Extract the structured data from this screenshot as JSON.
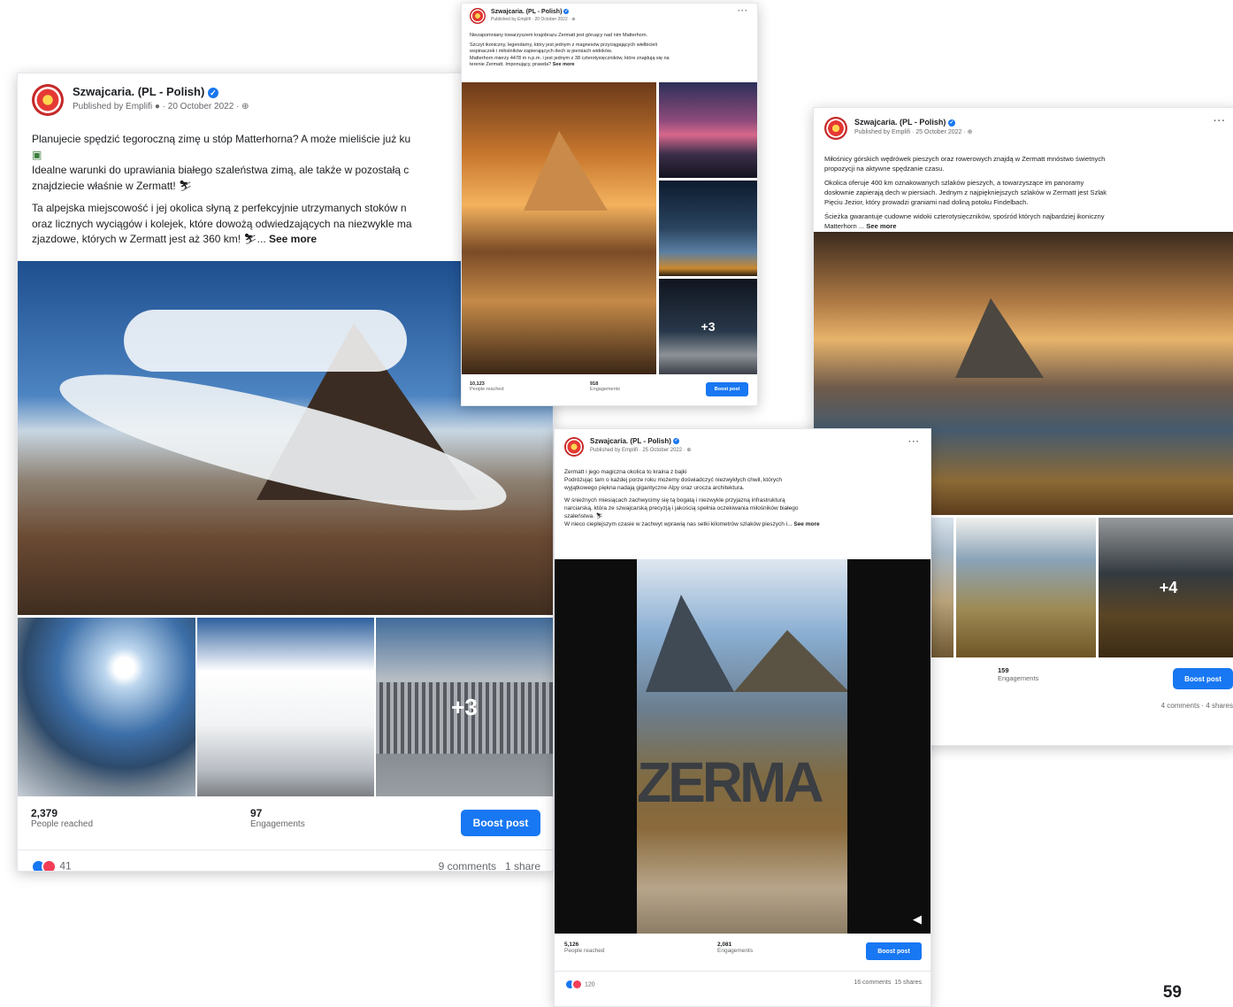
{
  "page_number": "59",
  "posts": [
    {
      "page_name": "Szwajcaria. (PL - Polish)",
      "published_by": "Published by Emplifi",
      "date": "20 October 2022",
      "text": [
        "Planujecie spędzić tegoroczną zimę u stóp Matterhorna? A może mieliście już ku",
        "Idealne warunki do uprawiania białego szaleństwa zimą, ale także w pozostałą c",
        "znajdziecie właśnie w Zermatt! ⛷",
        "Ta alpejska miejscowość i jej okolica słyną z perfekcyjnie utrzymanych stoków n",
        "oraz licznych wyciągów i kolejek, które dowożą odwiedzających na niezwykle ma",
        "zjazdowe, których w Zermatt jest aż 360 km! ⛷... "
      ],
      "see_more": "See more",
      "more_photos": "+3",
      "reach_value": "2,379",
      "reach_label": "People reached",
      "engage_value": "97",
      "engage_label": "Engagements",
      "boost": "Boost post",
      "reactions": "41",
      "comments": "9 comments",
      "shares": "1 share"
    },
    {
      "page_name": "Szwajcaria. (PL - Polish)",
      "published_by": "Published by Emplifi",
      "date": "20 October 2022",
      "text": [
        "Niezapomniany towarzyszem krajobrazu Zermatt jest góruący nad nim Matterhorn.",
        "Szczyt ikoniczny, legendarny, który jest jednym z magnesów przyciągających wielbicieli",
        "wspinaczek i miłośników zapierających dech w piersiach widoków.",
        "Matterhorn mierzy 4478 m n.p.m. i jest jednym z 38 czterotysięczników, które znajdują się na",
        "terenie Zermatt. Imponujący, prawda? "
      ],
      "see_more": "See more",
      "more_photos": "+3",
      "reach_value": "10,123",
      "reach_label": "People reached",
      "engage_value": "918",
      "engage_label": "Engagements",
      "boost": "Boost post"
    },
    {
      "page_name": "Szwajcaria. (PL - Polish)",
      "published_by": "Published by Emplifi",
      "date": "25 October 2022",
      "text": [
        "Miłośnicy górskich wędrówek pieszych oraz rowerowych znajdą w Zermatt mnóstwo świetnych",
        "propozycji na aktywne spędzanie czasu.",
        "Okolica oferuje 400 km oznakowanych szlaków pieszych, a towarzyszące im panoramy",
        "dosłownie zapierają dech w piersiach. Jednym z najpiękniejszych szlaków w Zermatt jest Szlak",
        "Pięciu Jezior, który prowadzi graniami nad doliną potoku Findelbach.",
        "Ścieżka gwarantuje cudowne widoki czterotysięczników, spośród których najbardziej ikoniczny",
        "Matterhorn ... "
      ],
      "see_more": "See more",
      "more_photos": "+4",
      "engage_value": "159",
      "engage_label": "Engagements",
      "boost": "Boost post",
      "comments": "4 comments",
      "shares": "4 shares"
    },
    {
      "page_name": "Szwajcaria. (PL - Polish)",
      "published_by": "Published by Emplifi",
      "date": "25 October 2022",
      "text": [
        "Zermatt i jego magiczna okolica to kraina z bajki",
        "Podróżując tam o każdej porze roku możemy doświadczyć niezwykłych chwil, których",
        "wyjątkowego piękna nadają gigantyczne Alpy oraz urocza architektura.",
        "W śnieżnych miesiącach zachwycimy się tą bogatą i niezwykle przyjazną infrastrukturą",
        "narciarską, która ze szwajcarską precyzją i jakością spełnia oczekiwania miłośników białego",
        "szaleństwa. ⛷",
        "W nieco cieplejszym czasie w zachwyt wprawią nas setki kilometrów szlaków pieszych i... "
      ],
      "see_more": "See more",
      "video_sign": "ZERMA",
      "reach_value": "5,126",
      "reach_label": "People reached",
      "engage_value": "2,081",
      "engage_label": "Engagements",
      "boost": "Boost post",
      "reactions": "120",
      "comments": "16 comments",
      "shares": "15 shares"
    }
  ]
}
